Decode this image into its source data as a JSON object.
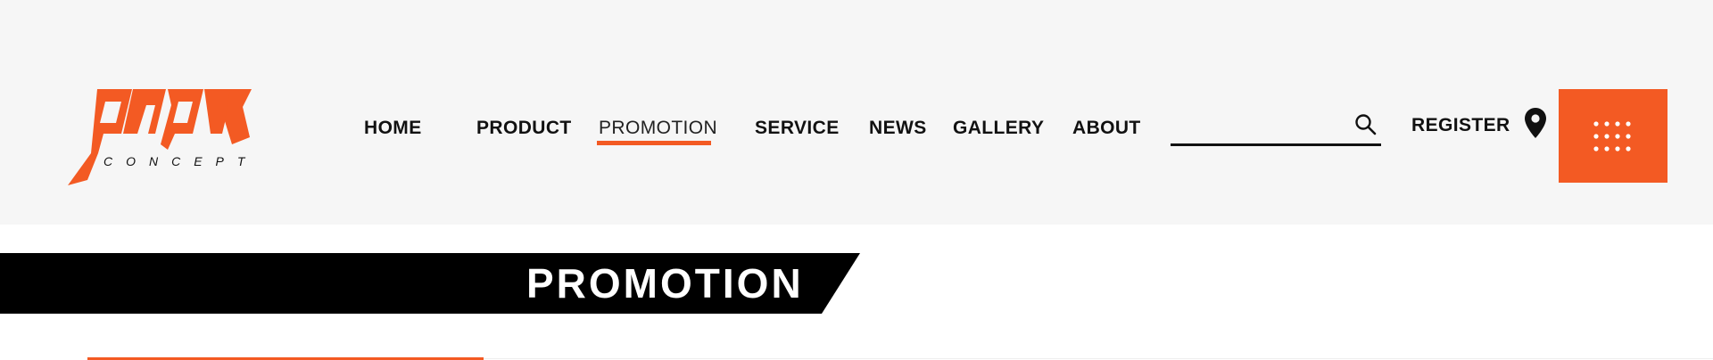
{
  "brand": {
    "logo_text": "MPK",
    "logo_subtext": "CONCEPT",
    "accent_color": "#f35a23"
  },
  "nav": {
    "items": [
      {
        "label": "HOME"
      },
      {
        "label": "PRODUCT"
      },
      {
        "label": "PROMOTION",
        "active": true
      },
      {
        "label": "SERVICE"
      },
      {
        "label": "NEWS"
      },
      {
        "label": "GALLERY"
      },
      {
        "label": "ABOUT"
      }
    ]
  },
  "search": {
    "value": "",
    "icon": "search-icon"
  },
  "header_actions": {
    "register_label": "REGISTER",
    "location_icon": "map-pin-icon",
    "menu_icon": "grid-dots-icon"
  },
  "page": {
    "title": "PROMOTION"
  }
}
